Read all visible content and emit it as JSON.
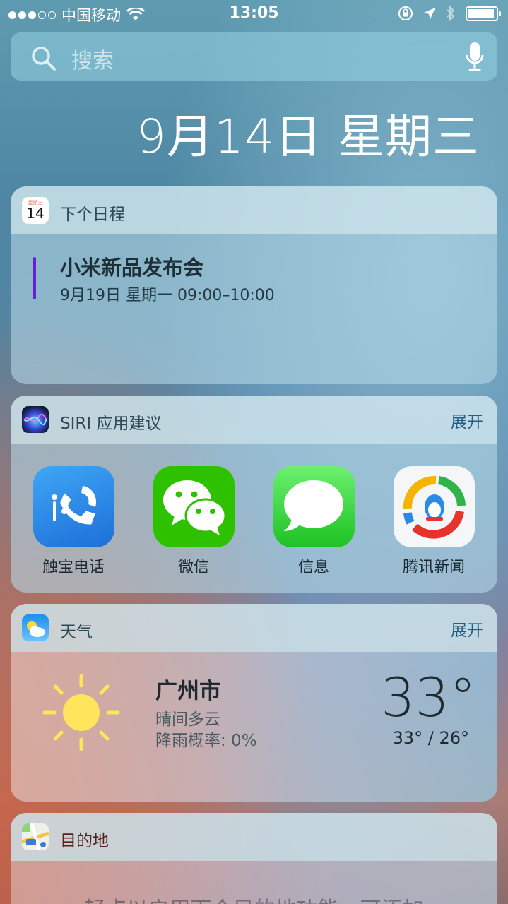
{
  "status_bar": {
    "carrier": "中国移动",
    "time": "13:05",
    "signal_dots_filled": 3,
    "signal_dots_total": 5,
    "battery_level": 0.95
  },
  "search": {
    "placeholder": "搜索"
  },
  "date_header": "9月14日 星期三",
  "calendar_widget": {
    "title": "下个日程",
    "icon_month": "星期三",
    "icon_day": "14",
    "event_title": "小米新品发布会",
    "event_time": "9月19日 星期一 09:00–10:00",
    "event_color": "#6a1fd6"
  },
  "siri_widget": {
    "title": "SIRI 应用建议",
    "action": "展开",
    "apps": [
      {
        "label": "触宝电话",
        "icon": "phone-dial-icon"
      },
      {
        "label": "微信",
        "icon": "wechat-icon"
      },
      {
        "label": "信息",
        "icon": "messages-icon"
      },
      {
        "label": "腾讯新闻",
        "icon": "tencent-news-icon"
      }
    ]
  },
  "weather_widget": {
    "title": "天气",
    "action": "展开",
    "city": "广州市",
    "condition": "晴间多云",
    "rain_chance": "降雨概率: 0%",
    "temperature": "33°",
    "range": "33° / 26°"
  },
  "destination_widget": {
    "title": "目的地",
    "hint": "轻点以启用下个目的地功能，可添加"
  }
}
